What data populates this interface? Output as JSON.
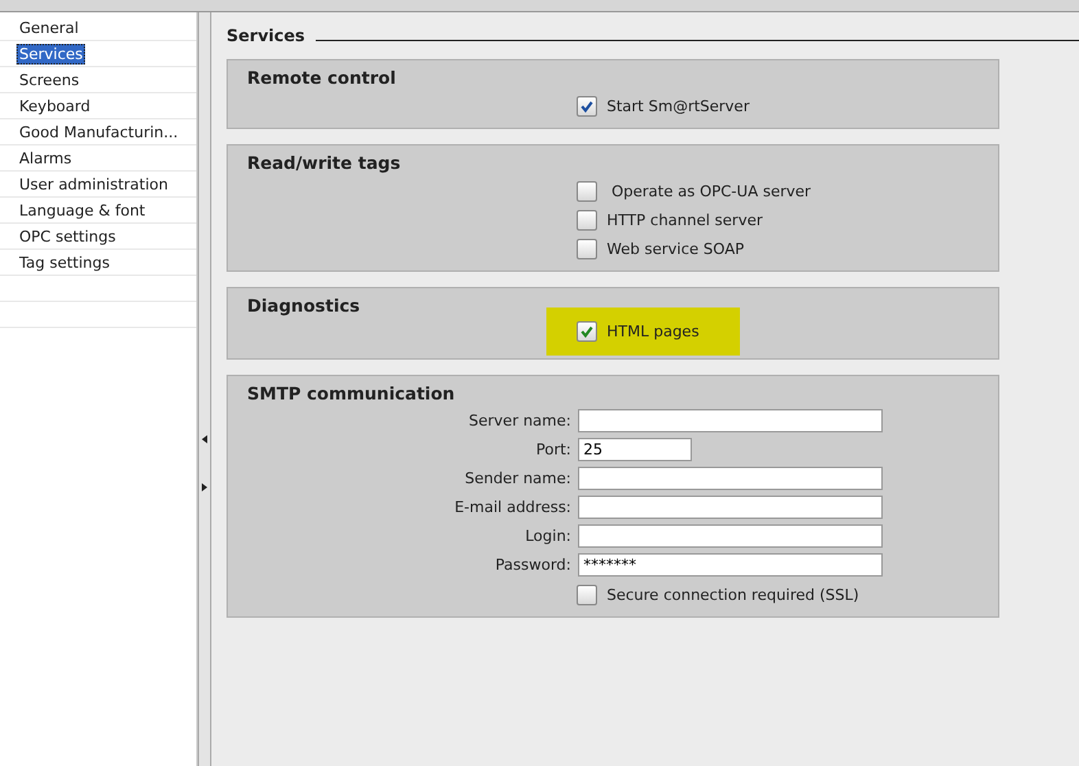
{
  "sidebar": {
    "items": [
      {
        "label": "General",
        "selected": false
      },
      {
        "label": "Services",
        "selected": true
      },
      {
        "label": "Screens",
        "selected": false
      },
      {
        "label": "Keyboard",
        "selected": false
      },
      {
        "label": "Good Manufacturin...",
        "selected": false
      },
      {
        "label": "Alarms",
        "selected": false
      },
      {
        "label": "User administration",
        "selected": false
      },
      {
        "label": "Language & font",
        "selected": false
      },
      {
        "label": "OPC settings",
        "selected": false
      },
      {
        "label": "Tag settings",
        "selected": false
      }
    ]
  },
  "page": {
    "title": "Services"
  },
  "groups": [
    {
      "title": "Remote control",
      "options": [
        {
          "label": "Start Sm@rtServer",
          "checked": true,
          "highlighted": false
        }
      ]
    },
    {
      "title": "Read/write tags",
      "options": [
        {
          "label": " Operate as OPC-UA server",
          "checked": false,
          "highlighted": false
        },
        {
          "label": "HTTP channel server",
          "checked": false,
          "highlighted": false
        },
        {
          "label": "Web service SOAP",
          "checked": false,
          "highlighted": false
        }
      ]
    },
    {
      "title": "Diagnostics",
      "options": [
        {
          "label": "HTML pages",
          "checked": true,
          "highlighted": true
        }
      ]
    },
    {
      "title": "SMTP communication",
      "fields": [
        {
          "label": "Server name:",
          "kind": "wide"
        },
        {
          "label": "Port:",
          "value": "25",
          "kind": "short"
        },
        {
          "label": "Sender name:",
          "kind": "wide"
        },
        {
          "label": "E-mail address:",
          "kind": "wide"
        },
        {
          "label": "Login:",
          "kind": "wide"
        },
        {
          "label": "Password:",
          "value": "*******",
          "kind": "wide"
        }
      ],
      "options": [
        {
          "label": "Secure connection required (SSL)",
          "checked": false,
          "highlighted": false
        }
      ]
    }
  ]
}
